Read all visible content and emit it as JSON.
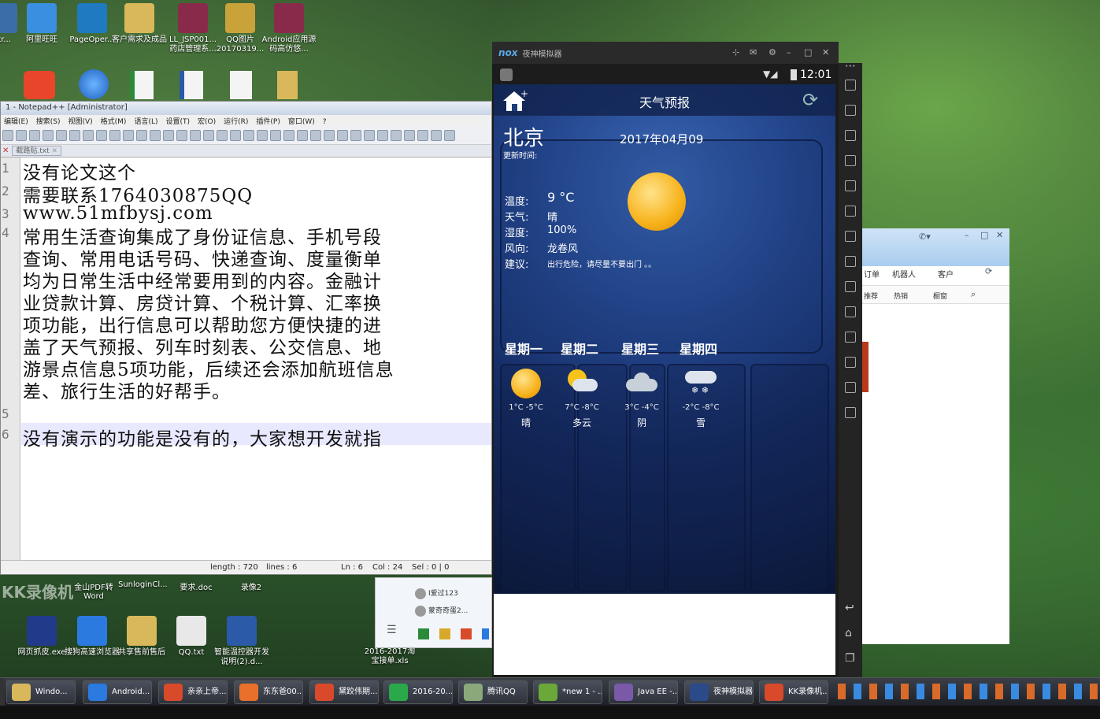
{
  "desktop": {
    "icons_top": [
      {
        "label": "str...",
        "color": "#3b6ea8"
      },
      {
        "label": "阿里旺旺",
        "color": "#3a8fe0"
      },
      {
        "label": "PageOper...",
        "color": "#1f7ac2"
      },
      {
        "label": "客户需求及成品",
        "color": "#d8b85a"
      },
      {
        "label": "LL_JSP001...药店管理系...",
        "color": "#8a2a4a"
      },
      {
        "label": "QQ图片20170319...",
        "color": "#c9a23a"
      },
      {
        "label": "Android应用源码高仿悠...",
        "color": "#8a2a4a"
      }
    ],
    "icons_bottom": [
      {
        "label": "网页抓皮.exe",
        "color": "#223a8a"
      },
      {
        "label": "搜狗高速浏览器",
        "color": "#2a7ae0"
      },
      {
        "label": "共享售前售后",
        "color": "#d8b85a"
      },
      {
        "label": "QQ.txt",
        "color": "#e8e8e8"
      },
      {
        "label": "智能温控器开发说明(2).d...",
        "color": "#2a5aa8"
      },
      {
        "label": "2016-2017淘宝接单.xls",
        "color": "#2a8a3a"
      }
    ],
    "icons_mid": [
      {
        "label": "金山PDF转Word"
      },
      {
        "label": "SunloginCl..."
      },
      {
        "label": "要求.doc"
      },
      {
        "label": "录像2"
      }
    ],
    "watermark": "KK录像机"
  },
  "notepad": {
    "title": "1 - Notepad++ [Administrator]",
    "menu": [
      "编辑(E)",
      "搜索(S)",
      "视图(V)",
      "格式(M)",
      "语言(L)",
      "设置(T)",
      "宏(O)",
      "运行(R)",
      "插件(P)",
      "窗口(W)",
      "?"
    ],
    "tab": "截路贴.txt",
    "lines": [
      {
        "n": "1",
        "text": "没有论文这个"
      },
      {
        "n": "2",
        "text": "需要联系1764030875QQ"
      },
      {
        "n": "3",
        "text": "www.51mfbysj.com"
      },
      {
        "n": "4",
        "text": "常用生活查询集成了身份证信息、手机号段"
      },
      {
        "n": "",
        "text": "查询、常用电话号码、快递查询、度量衡单"
      },
      {
        "n": "",
        "text": "均为日常生活中经常要用到的内容。金融计"
      },
      {
        "n": "",
        "text": "业贷款计算、房贷计算、个税计算、汇率换"
      },
      {
        "n": "",
        "text": "项功能，出行信息可以帮助您方便快捷的进"
      },
      {
        "n": "",
        "text": "盖了天气预报、列车时刻表、公交信息、地"
      },
      {
        "n": "",
        "text": "游景点信息5项功能，后续还会添加航班信息"
      },
      {
        "n": "",
        "text": "差、旅行生活的好帮手。"
      },
      {
        "n": "5",
        "text": ""
      },
      {
        "n": "6",
        "text": "没有演示的功能是没有的，大家想开发就指"
      }
    ],
    "status": {
      "length": "length : 720",
      "lines": "lines : 6",
      "ln": "Ln : 6",
      "col": "Col : 24",
      "sel": "Sel : 0 | 0"
    }
  },
  "emulator": {
    "title": "夜神模拟器",
    "brand": "nox",
    "clock": "12:01",
    "app": {
      "title": "天气预报",
      "city": "北京",
      "update_label": "更新时间:",
      "date": "2017年04月09",
      "fields": [
        {
          "label": "温度:",
          "value": "9 °C"
        },
        {
          "label": "天气:",
          "value": "晴"
        },
        {
          "label": "湿度:",
          "value": "100%"
        },
        {
          "label": "风向:",
          "value": "龙卷风"
        },
        {
          "label": "建议:",
          "value": "出行危险，请尽量不要出门 。。"
        }
      ],
      "forecast": [
        {
          "day": "星期一",
          "temp": "1°C -5°C",
          "cond": "晴",
          "icon": "sun-icon"
        },
        {
          "day": "星期二",
          "temp": "7°C -8°C",
          "cond": "多云",
          "icon": "partly-cloudy-icon"
        },
        {
          "day": "星期三",
          "temp": "3°C -4°C",
          "cond": "阴",
          "icon": "cloud-icon"
        },
        {
          "day": "星期四",
          "temp": "-2°C -8°C",
          "cond": "雪",
          "icon": "snow-icon"
        }
      ]
    }
  },
  "qq_window": {
    "tabs": [
      "订单",
      "机器人",
      "客户"
    ],
    "subtabs": [
      "推荐",
      "热销",
      "橱窗"
    ],
    "contacts": [
      "I爱过123",
      "蒙奇奇蛋2..."
    ]
  },
  "taskbar": {
    "items": [
      {
        "label": "Windo...",
        "color": "#d8b85a"
      },
      {
        "label": "Android...",
        "color": "#2a7ae0"
      },
      {
        "label": "亲亲上帝...",
        "color": "#d84a2a"
      },
      {
        "label": "东东爸00...",
        "color": "#e8702a"
      },
      {
        "label": "黛跤伟期...",
        "color": "#d84a2a"
      },
      {
        "label": "2016-20...",
        "color": "#2aa84a"
      },
      {
        "label": "腾讯QQ",
        "color": "#8aa87a"
      },
      {
        "label": "*new 1 - ...",
        "color": "#6aa83a"
      },
      {
        "label": "Java EE -...",
        "color": "#7a5aa8"
      },
      {
        "label": "夜神模拟器",
        "color": "#2a4a8a"
      },
      {
        "label": "KK录像机...",
        "color": "#d84a2a"
      }
    ]
  }
}
